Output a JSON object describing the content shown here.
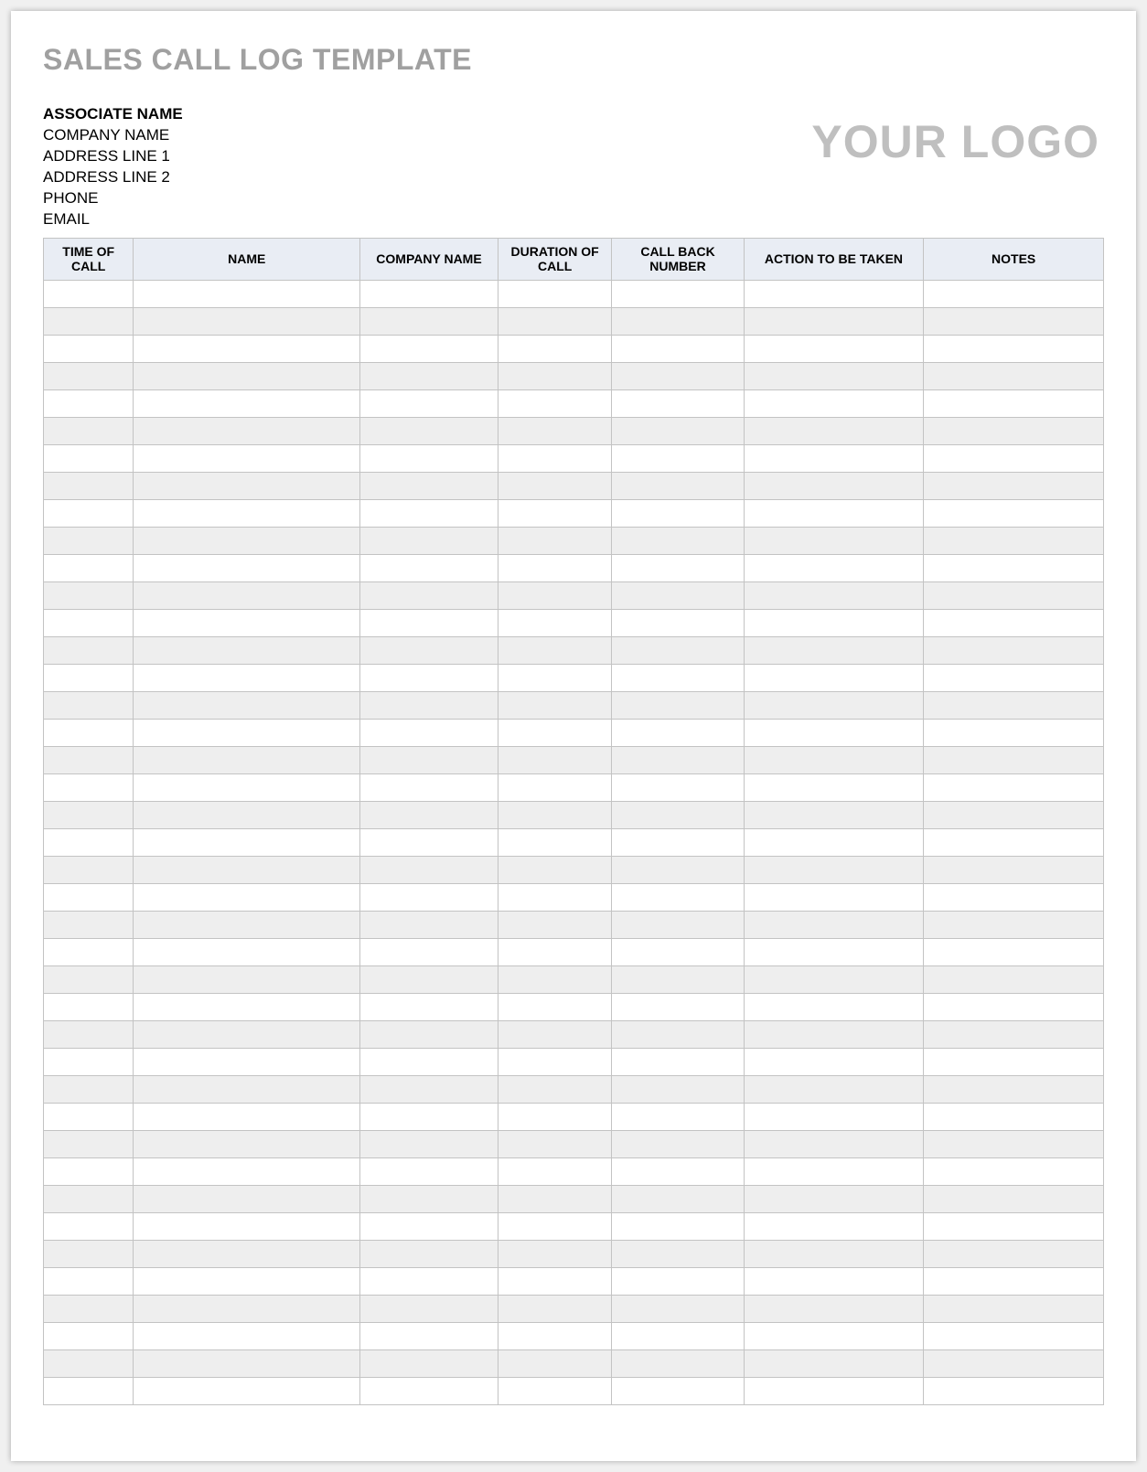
{
  "title": "SALES CALL LOG TEMPLATE",
  "address": {
    "associate_name": "ASSOCIATE NAME",
    "company_name": "COMPANY NAME",
    "address_line_1": "ADDRESS LINE 1",
    "address_line_2": "ADDRESS LINE 2",
    "phone": "PHONE",
    "email": "EMAIL"
  },
  "logo_text": "YOUR LOGO",
  "table": {
    "headers": [
      "TIME OF CALL",
      "NAME",
      "COMPANY NAME",
      "DURATION OF CALL",
      "CALL BACK NUMBER",
      "ACTION TO BE TAKEN",
      "NOTES"
    ],
    "row_count": 41
  }
}
